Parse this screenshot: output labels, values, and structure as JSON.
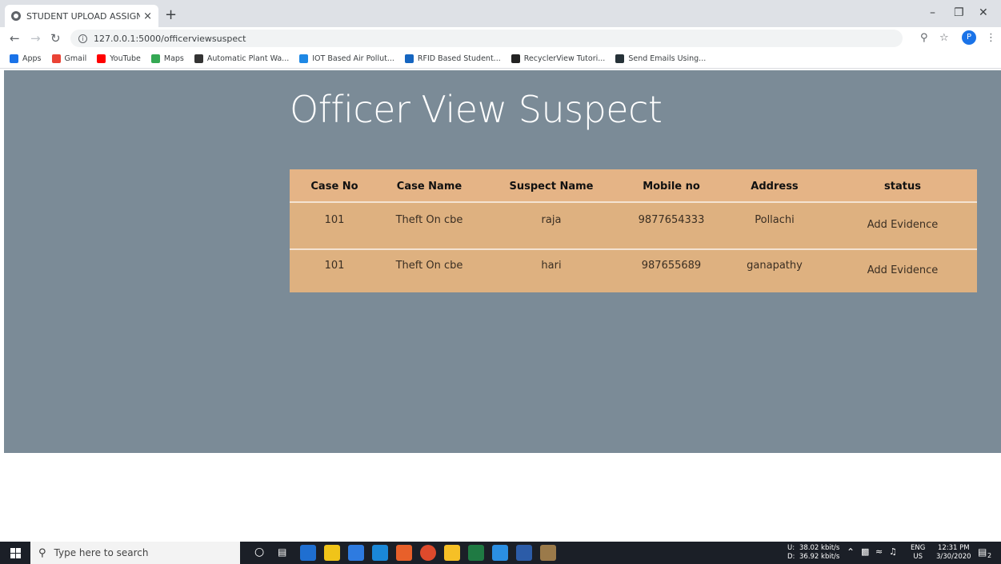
{
  "browser": {
    "tab_title": "STUDENT UPLOAD ASSIGNMENT",
    "tab_close": "×",
    "new_tab": "+",
    "url": "127.0.0.1:5000/officerviewsuspect",
    "profile_initial": "P",
    "bookmarks": [
      {
        "label": "Apps",
        "color": "#1a73e8"
      },
      {
        "label": "Gmail",
        "color": "#ea4335"
      },
      {
        "label": "YouTube",
        "color": "#ff0000"
      },
      {
        "label": "Maps",
        "color": "#34a853"
      },
      {
        "label": "Automatic Plant Wa...",
        "color": "#333333"
      },
      {
        "label": "IOT Based Air Pollut...",
        "color": "#1e88e5"
      },
      {
        "label": "RFID Based Student...",
        "color": "#1565c0"
      },
      {
        "label": "RecyclerView Tutori...",
        "color": "#222222"
      },
      {
        "label": "Send Emails Using...",
        "color": "#263238"
      }
    ]
  },
  "page": {
    "title": "Officer View Suspect",
    "background": "#7b8b97",
    "table_color": "#deb180",
    "columns": [
      "Case No",
      "Case Name",
      "Suspect Name",
      "Mobile no",
      "Address",
      "status"
    ],
    "rows": [
      {
        "case_no": "101",
        "case_name": "Theft On cbe",
        "suspect_name": "raja",
        "mobile": "9877654333",
        "address": "Pollachi",
        "status": "Add Evidence"
      },
      {
        "case_no": "101",
        "case_name": "Theft On cbe",
        "suspect_name": "hari",
        "mobile": "987655689",
        "address": "ganapathy",
        "status": "Add Evidence"
      }
    ]
  },
  "taskbar": {
    "search_placeholder": "Type here to search",
    "net_up_label": "U:",
    "net_up": "38.02 kbit/s",
    "net_down_label": "D:",
    "net_down": "36.92 kbit/s",
    "lang": "ENG",
    "region": "US",
    "time": "12:31 PM",
    "date": "3/30/2020",
    "notifications": "2"
  }
}
